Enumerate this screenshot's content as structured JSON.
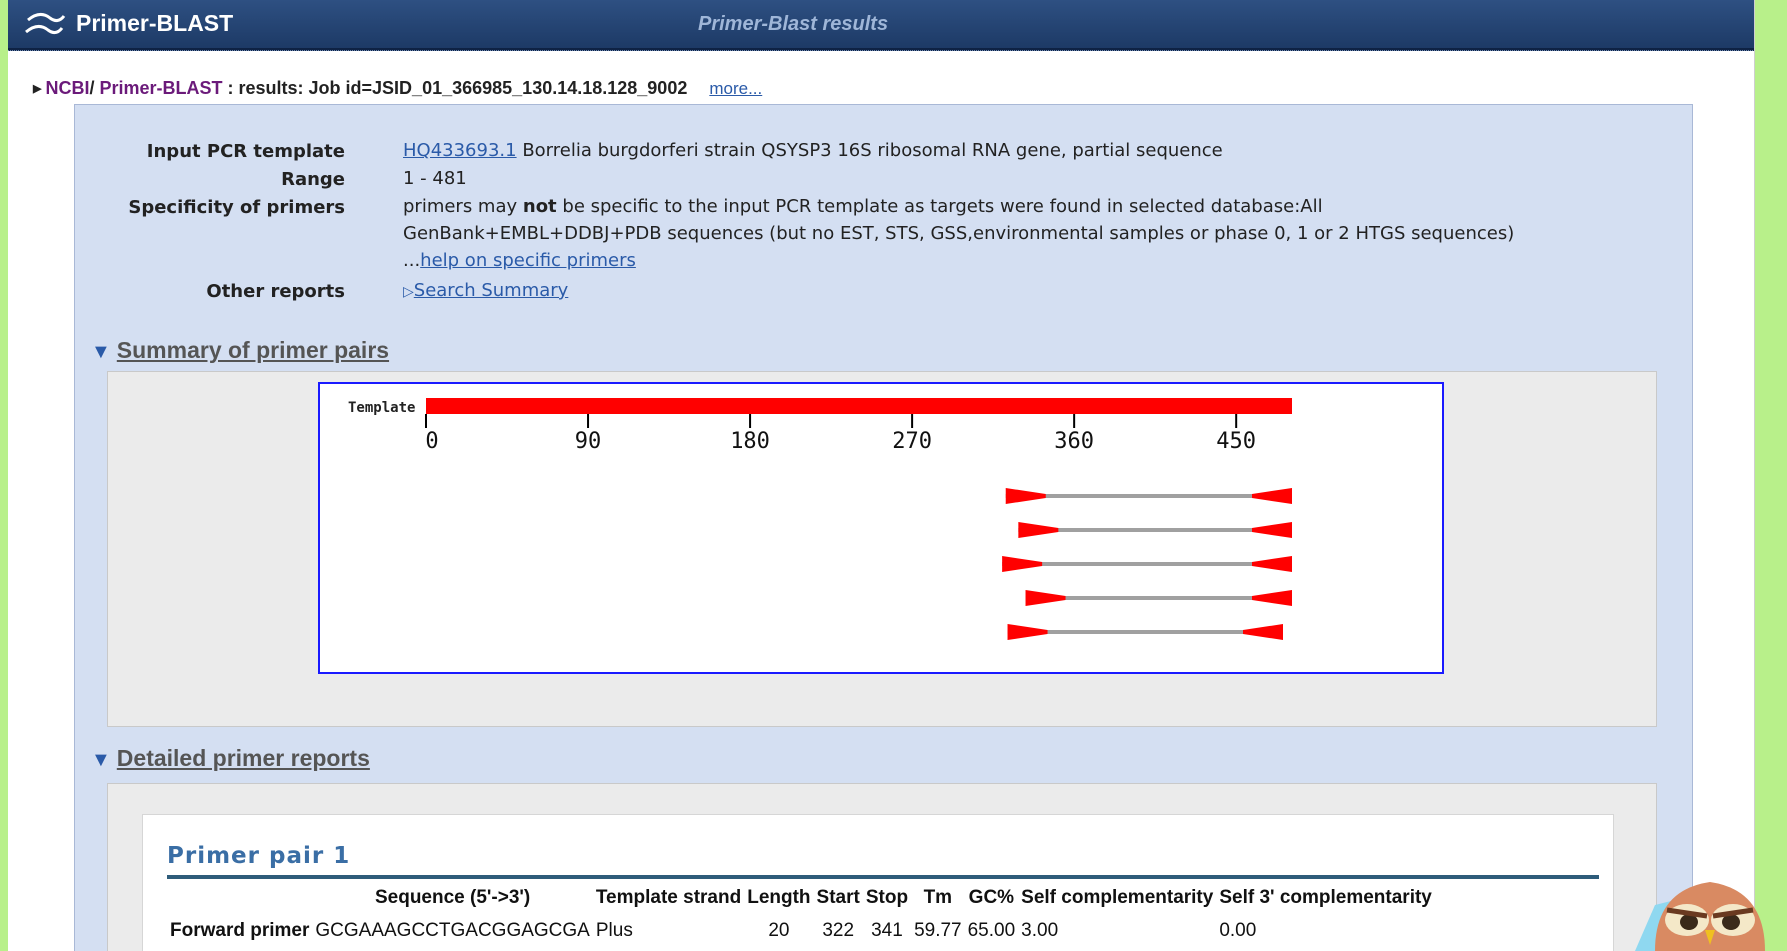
{
  "header": {
    "app_title": "Primer-BLAST",
    "page_heading": "Primer-Blast results"
  },
  "breadcrumb": {
    "ncbi": "NCBI",
    "sep": "/ ",
    "tool": "Primer-BLAST",
    "rest": " : results: Job id=JSID_01_366985_130.14.18.128_9002",
    "more": "more..."
  },
  "info": {
    "template_label": "Input PCR template",
    "template_accession": "HQ433693.1",
    "template_desc": " Borrelia burgdorferi strain QSYSP3 16S ribosomal RNA gene, partial sequence",
    "range_label": "Range",
    "range_value": "1 - 481",
    "specificity_label": "Specificity of primers",
    "specificity_pre": "primers may ",
    "specificity_bold": "not",
    "specificity_post": " be specific to the input PCR template as targets were found in selected database:All GenBank+EMBL+DDBJ+PDB sequences (but no EST, STS, GSS,environmental samples or phase 0, 1 or 2 HTGS sequences) ...",
    "specificity_link": "help on specific primers",
    "other_label": "Other reports",
    "other_link": "Search Summary"
  },
  "sections": {
    "summary_title": "Summary of primer pairs",
    "detail_title": "Detailed primer reports"
  },
  "graphic": {
    "template_label": "Template",
    "template_length": 481,
    "ticks": [
      0,
      90,
      180,
      270,
      360,
      450
    ],
    "pairs": [
      {
        "start": 322,
        "stop": 481
      },
      {
        "start": 329,
        "stop": 481
      },
      {
        "start": 320,
        "stop": 481
      },
      {
        "start": 333,
        "stop": 481
      },
      {
        "start": 323,
        "stop": 476
      }
    ],
    "colors": {
      "bar": "#ff0000",
      "line": "#a0a0a0"
    }
  },
  "pair1": {
    "title": "Primer pair 1",
    "headers": [
      "",
      "Sequence (5'->3')",
      "Template strand",
      "Length",
      "Start",
      "Stop",
      "Tm",
      "GC%",
      "Self complementarity",
      "Self 3' complementarity"
    ],
    "forward": {
      "label": "Forward primer",
      "sequence": "GCGAAAGCCTGACGGAGCGA",
      "strand": "Plus",
      "length": "20",
      "start": "322",
      "stop": "341",
      "tm": "59.77",
      "gc": "65.00",
      "self": "3.00",
      "self3": "0.00"
    }
  }
}
